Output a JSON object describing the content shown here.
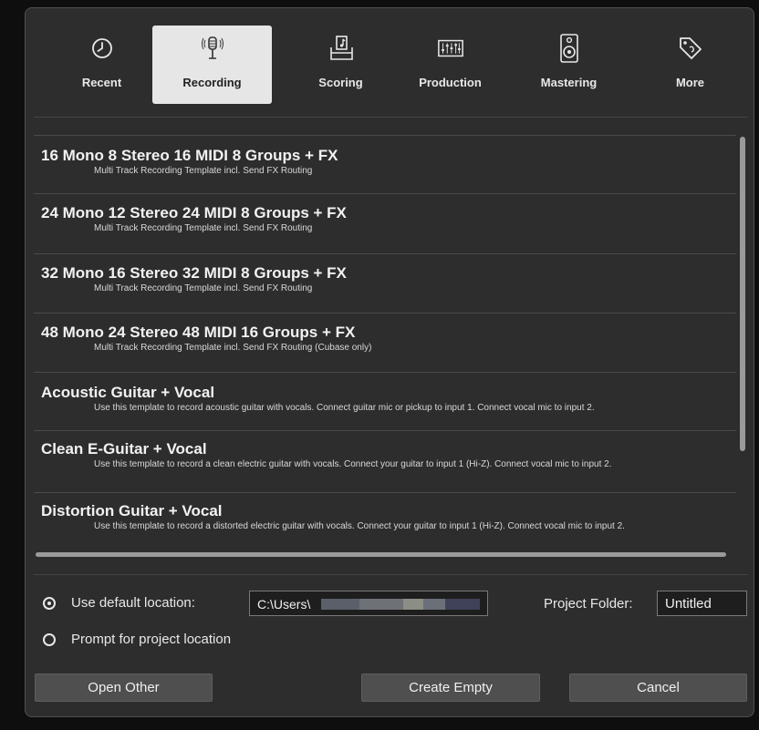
{
  "categories": [
    {
      "label": "Recent",
      "icon": "clock-icon",
      "active": false
    },
    {
      "label": "Recording",
      "icon": "microphone-icon",
      "active": true
    },
    {
      "label": "Scoring",
      "icon": "score-icon",
      "active": false
    },
    {
      "label": "Production",
      "icon": "mixer-icon",
      "active": false
    },
    {
      "label": "Mastering",
      "icon": "speaker-icon",
      "active": false
    },
    {
      "label": "More",
      "icon": "tag-icon",
      "active": false
    }
  ],
  "templates": [
    {
      "title": "16 Mono 8 Stereo 16 MIDI 8 Groups + FX",
      "desc": "Multi Track Recording Template incl. Send FX Routing"
    },
    {
      "title": "24 Mono 12 Stereo 24 MIDI 8 Groups + FX",
      "desc": "Multi Track Recording Template incl. Send FX Routing"
    },
    {
      "title": "32 Mono 16 Stereo 32 MIDI 8 Groups + FX",
      "desc": "Multi Track Recording Template incl. Send FX Routing"
    },
    {
      "title": "48 Mono 24 Stereo 48 MIDI 16 Groups + FX",
      "desc": "Multi Track Recording Template incl. Send FX Routing (Cubase only)"
    },
    {
      "title": "Acoustic Guitar + Vocal",
      "desc": "Use this template to record acoustic guitar with vocals. Connect guitar mic or pickup to input  1. Connect vocal mic to input 2."
    },
    {
      "title": "Clean E-Guitar + Vocal",
      "desc": "Use this template to record a clean electric guitar with vocals. Connect your guitar to input  1 (Hi-Z). Connect vocal mic to input 2."
    },
    {
      "title": "Distortion Guitar + Vocal",
      "desc": "Use this template to record a distorted electric guitar with vocals. Connect your guitar to input  1 (Hi-Z). Connect vocal mic to input 2."
    }
  ],
  "location": {
    "default_label": "Use default location:",
    "prompt_label": "Prompt for project location",
    "path_value": "C:\\Users\\",
    "default_selected": true
  },
  "project_folder": {
    "label": "Project Folder:",
    "value": "Untitled"
  },
  "buttons": {
    "open_other": "Open Other",
    "create_empty": "Create Empty",
    "cancel": "Cancel"
  },
  "colors": {
    "window_bg": "#2d2d2d",
    "active_tab_bg": "#e6e6e6",
    "button_bg": "#4f4f4f"
  }
}
